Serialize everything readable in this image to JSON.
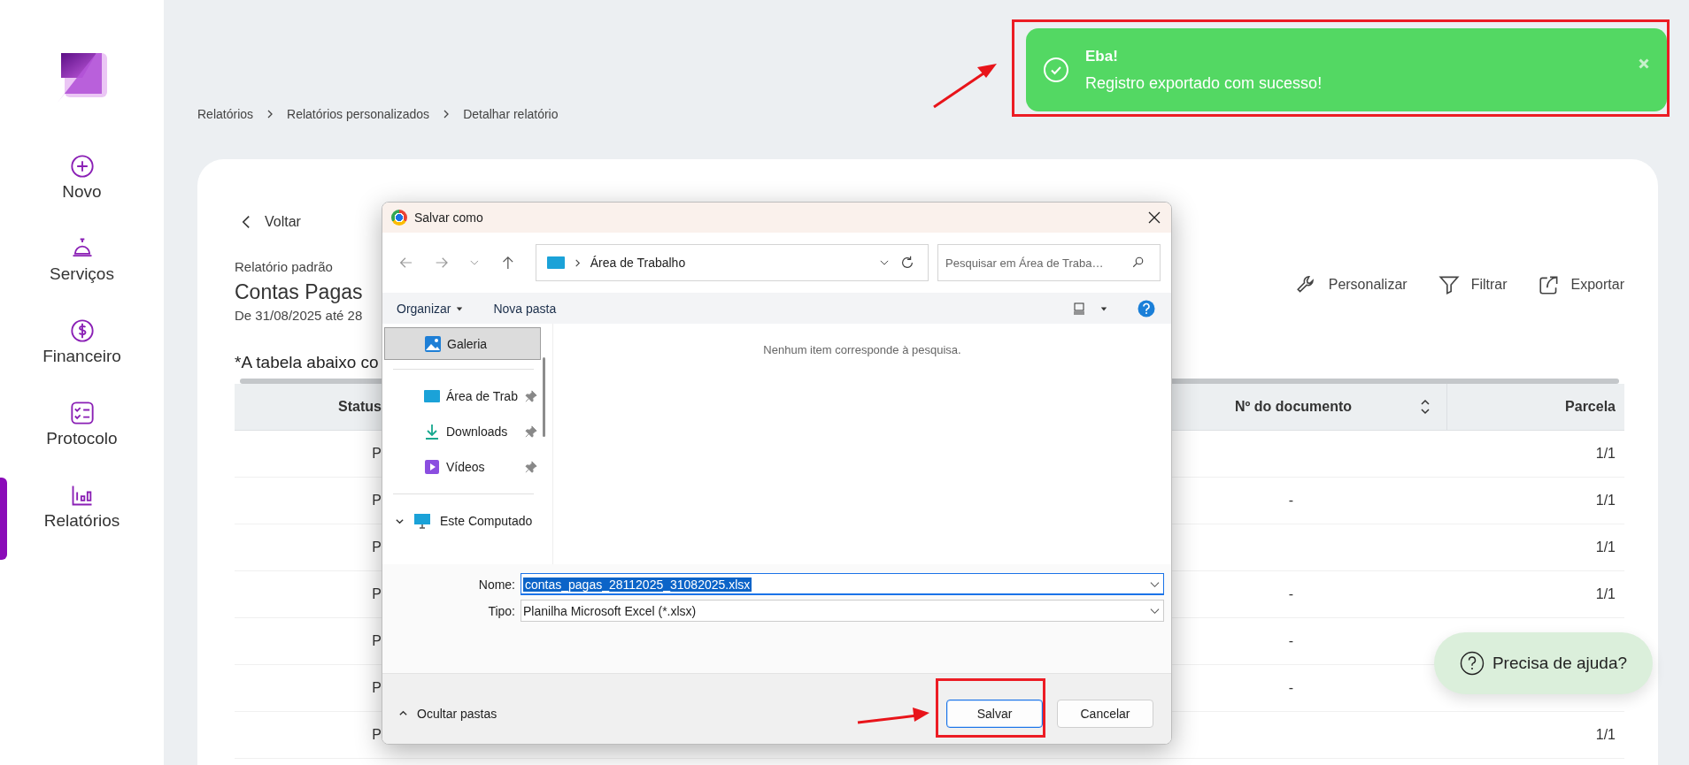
{
  "sidebar": {
    "items": [
      {
        "label": "Novo",
        "kind": "plus",
        "selected": false
      },
      {
        "label": "Serviços",
        "kind": "bell",
        "selected": false
      },
      {
        "label": "Financeiro",
        "kind": "dollar",
        "selected": false
      },
      {
        "label": "Protocolo",
        "kind": "checklist",
        "selected": false
      },
      {
        "label": "Relatórios",
        "kind": "chart",
        "selected": true
      }
    ]
  },
  "breadcrumb": [
    "Relatórios",
    "Relatórios personalizados",
    "Detalhar relatório"
  ],
  "toast": {
    "title": "Eba!",
    "message": "Registro exportado com sucesso!"
  },
  "report": {
    "back": "Voltar",
    "subtitle": "Relatório padrão",
    "title": "Contas Pagas",
    "period": "De 31/08/2025 até 28",
    "note": "*A tabela abaixo co",
    "actions": [
      {
        "label": "Personalizar",
        "kind": "wrench"
      },
      {
        "label": "Filtrar",
        "kind": "filter"
      },
      {
        "label": "Exportar",
        "kind": "share"
      }
    ]
  },
  "table": {
    "columns": [
      {
        "label": "Status",
        "sortable": false
      },
      {
        "label": "Nº do documento",
        "sortable": true
      },
      {
        "label": "Parcela",
        "sortable": false
      }
    ],
    "rows": [
      {
        "status": "P",
        "installment": "1/1"
      },
      {
        "status": "P",
        "document": "-",
        "installment": "1/1"
      },
      {
        "status": "P",
        "installment": "1/1"
      },
      {
        "status": "P",
        "document": "-",
        "installment": "1/1"
      },
      {
        "status": "P",
        "document": "-"
      },
      {
        "status": "P",
        "document": "-"
      },
      {
        "status": "P",
        "installment": "1/1"
      }
    ]
  },
  "dialog": {
    "title": "Salvar como",
    "address": "Área de Trabalho",
    "search": {
      "placeholder": "Pesquisar em Área de Traba…"
    },
    "toolbar": [
      "Organizar",
      "Nova pasta"
    ],
    "nav_items": [
      {
        "label": "Galeria",
        "kind": "gallery",
        "selected": true,
        "pinned": false
      },
      {
        "label": "Área de Trab",
        "kind": "desktop",
        "selected": false,
        "pinned": true
      },
      {
        "label": "Downloads",
        "kind": "download",
        "selected": false,
        "pinned": true
      },
      {
        "label": "Vídeos",
        "kind": "video",
        "selected": false,
        "pinned": true
      }
    ],
    "tree": {
      "label": "Este Computado",
      "expanded": true
    },
    "empty_message": "Nenhum item corresponde à pesquisa.",
    "fields": [
      {
        "label": "Nome:",
        "value": "contas_pagas_28112025_31082025.xlsx",
        "focused": true
      },
      {
        "label": "Tipo:",
        "value": "Planilha Microsoft Excel (*.xlsx)",
        "focused": false
      }
    ],
    "toggle": "Ocultar pastas",
    "buttons": [
      {
        "label": "Salvar",
        "kind": "primary"
      },
      {
        "label": "Cancelar",
        "kind": "secondary"
      }
    ]
  },
  "help_button": {
    "label": "Precisa de ajuda?"
  }
}
